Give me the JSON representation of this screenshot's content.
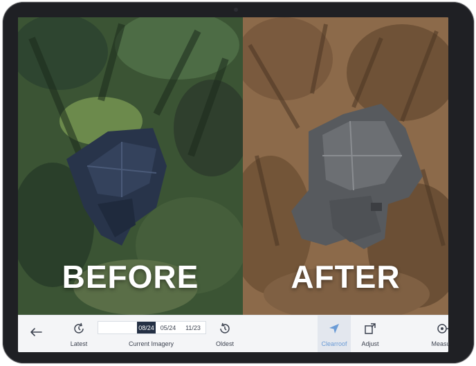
{
  "imagery": {
    "before_label": "BEFORE",
    "after_label": "AFTER"
  },
  "toolbar": {
    "back_icon": "arrow-left-icon",
    "latest_label": "Latest",
    "current_imagery_label": "Current Imagery",
    "dates": [
      "08/24",
      "05/24",
      "11/23"
    ],
    "selected_date": "08/24",
    "oldest_label": "Oldest",
    "clearroof_label": "Clearroof",
    "adjust_label": "Adjust",
    "measure_label": "Measure"
  },
  "colors": {
    "accent": "#6a9bd6",
    "selected_date_bg": "#243044",
    "device_frame": "#1f2024"
  }
}
